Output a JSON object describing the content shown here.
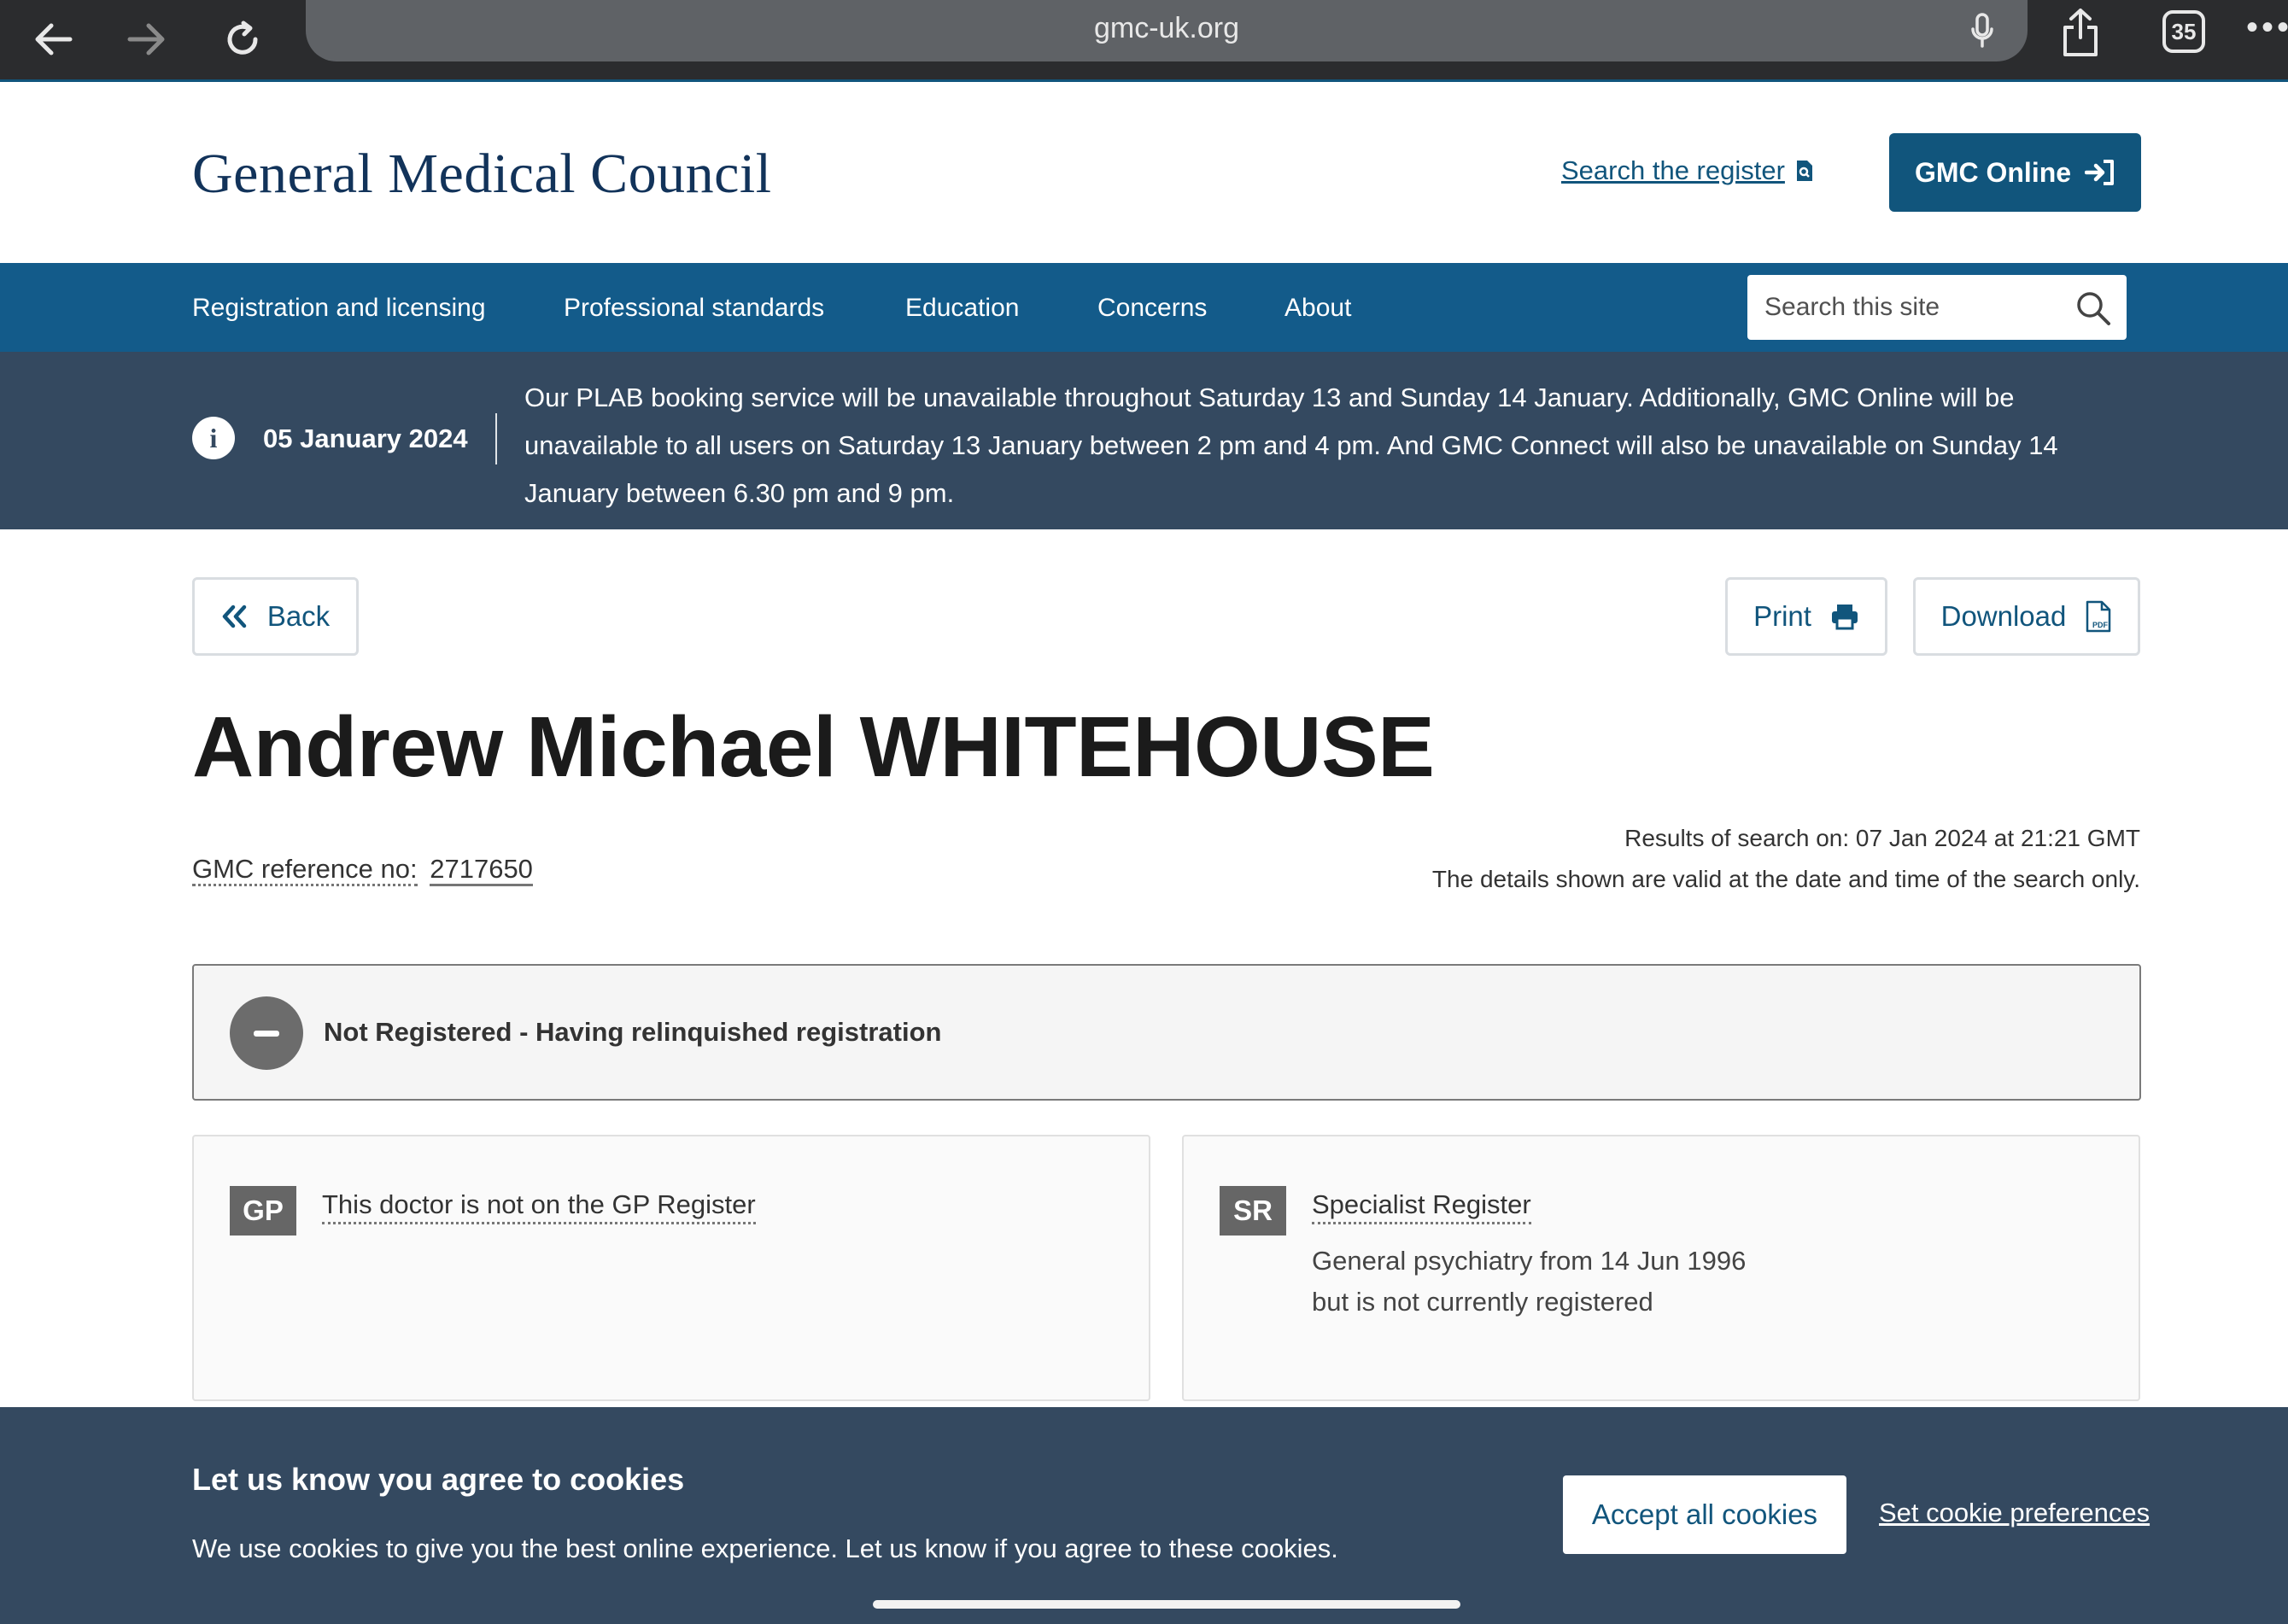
{
  "browser": {
    "url": "gmc-uk.org",
    "tab_count": "35"
  },
  "header": {
    "logo": "General Medical Council",
    "search_register": "Search the register",
    "gmc_online": "GMC Online"
  },
  "nav": {
    "items": [
      "Registration and licensing",
      "Professional standards",
      "Education",
      "Concerns",
      "About"
    ],
    "search_placeholder": "Search this site"
  },
  "alert": {
    "date": "05 January 2024",
    "message": "Our PLAB booking service will be unavailable throughout Saturday 13 and Sunday 14 January. Additionally, GMC Online will be unavailable to all users on Saturday 13 January between 2 pm and 4 pm. And GMC Connect will also be unavailable on Sunday 14 January between 6.30 pm and 9 pm."
  },
  "actions": {
    "back": "Back",
    "print": "Print",
    "download": "Download"
  },
  "doctor": {
    "name": "Andrew Michael WHITEHOUSE",
    "ref_label": "GMC reference no:",
    "ref_number": "2717650",
    "search_results": "Results of search on: 07 Jan 2024 at 21:21 GMT",
    "validity_note": "The details shown are valid at the date and time of the search only."
  },
  "status": {
    "text": "Not Registered - Having relinquished registration"
  },
  "gp_card": {
    "badge": "GP",
    "title": "This doctor is not on the GP Register"
  },
  "sr_card": {
    "badge": "SR",
    "title": "Specialist Register",
    "line1": "General psychiatry from 14 Jun 1996",
    "line2": "but is not currently registered"
  },
  "cookie": {
    "title": "Let us know you agree to cookies",
    "text": "We use cookies to give you the best online experience. Let us know if you agree to these cookies.",
    "accept": "Accept all cookies",
    "preferences": "Set cookie preferences"
  }
}
